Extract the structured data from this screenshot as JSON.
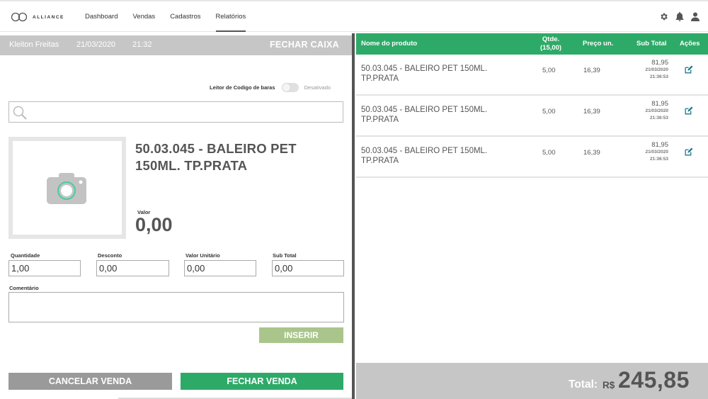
{
  "topbar": {
    "logo_text": "ALLIANCE",
    "nav": [
      "Dashboard",
      "Vendas",
      "Cadastros",
      "Relatórios"
    ],
    "active_nav": "Relatórios",
    "icons": [
      "gear-icon",
      "bell-icon",
      "user-icon"
    ]
  },
  "caixa": {
    "user": "Kleiton Freitas",
    "date": "21/03/2020",
    "time": "21:32",
    "close_label": "FECHAR CAIXA"
  },
  "barcode": {
    "label": "Leitor de Codigo de baras",
    "state": "Desativado"
  },
  "search": {
    "placeholder": ""
  },
  "product": {
    "title": "50.03.045 - BALEIRO PET 150ML. TP.PRATA",
    "valor_label": "Valor",
    "valor": "0,00"
  },
  "fields": {
    "quantidade_label": "Quantidade",
    "quantidade": "1,00",
    "desconto_label": "Desconto",
    "desconto": "0,00",
    "valor_unitario_label": "Valor Unitário",
    "valor_unitario": "0,00",
    "subtotal_label": "Sub Total",
    "subtotal": "0,00",
    "comentario_label": "Comentário",
    "comentario": ""
  },
  "buttons": {
    "inserir": "INSERIR",
    "cancelar": "CANCELAR VENDA",
    "fechar": "FECHAR VENDA"
  },
  "table": {
    "headers": {
      "nome": "Nome do produto",
      "qtde": "Qtde.",
      "qtde_total": "(15,00)",
      "preco": "Preço un.",
      "subtotal": "Sub Total",
      "acoes": "Ações"
    },
    "rows": [
      {
        "name": "50.03.045 - BALEIRO PET 150ML. TP.PRATA",
        "qty": "5,00",
        "price": "16,39",
        "sub": "81,95",
        "date": "21/03/2020",
        "time": "21:36:53"
      },
      {
        "name": "50.03.045 - BALEIRO PET 150ML. TP.PRATA",
        "qty": "5,00",
        "price": "16,39",
        "sub": "81,95",
        "date": "21/03/2020",
        "time": "21:36:53"
      },
      {
        "name": "50.03.045 - BALEIRO PET 150ML. TP.PRATA",
        "qty": "5,00",
        "price": "16,39",
        "sub": "81,95",
        "date": "21/03/2020",
        "time": "21:36:53"
      }
    ]
  },
  "total": {
    "label": "Total:",
    "currency": "R$",
    "value": "245,85"
  },
  "colors": {
    "green": "#2eaa68",
    "light_green": "#a9c58c",
    "gray_bar": "#c6c6c6",
    "cancel_gray": "#9a9a9a",
    "text": "#555555"
  }
}
